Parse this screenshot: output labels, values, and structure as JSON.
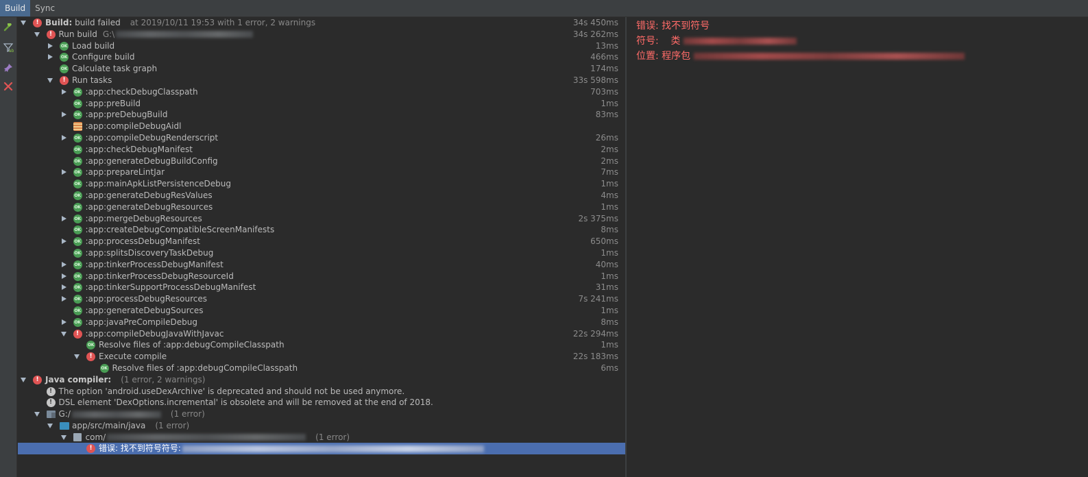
{
  "tabs": [
    "Build",
    "Sync"
  ],
  "toolbar": {
    "icons": [
      "hammer-icon",
      "filter-icon",
      "pin-icon",
      "close-icon"
    ]
  },
  "tree": {
    "rows": [
      {
        "indent": 0,
        "arrow": "exp",
        "icon": "err",
        "bold": "Build:",
        "text": " build failed",
        "dim": "at 2019/10/11 19:53   with 1 error, 2 warnings",
        "time": "34s 450ms"
      },
      {
        "indent": 1,
        "arrow": "exp",
        "icon": "err",
        "text": "Run build",
        "dim": "G:\\",
        "blur": 200,
        "time": "34s 262ms"
      },
      {
        "indent": 2,
        "arrow": "col",
        "icon": "ok",
        "text": "Load build",
        "time": "13ms"
      },
      {
        "indent": 2,
        "arrow": "col",
        "icon": "ok",
        "text": "Configure build",
        "time": "466ms"
      },
      {
        "indent": 2,
        "arrow": "",
        "icon": "ok",
        "text": "Calculate task graph",
        "time": "174ms"
      },
      {
        "indent": 2,
        "arrow": "exp",
        "icon": "err",
        "text": "Run tasks",
        "time": "33s 598ms"
      },
      {
        "indent": 3,
        "arrow": "col",
        "icon": "ok",
        "text": ":app:checkDebugClasspath",
        "time": "703ms"
      },
      {
        "indent": 3,
        "arrow": "",
        "icon": "ok",
        "text": ":app:preBuild",
        "time": "1ms"
      },
      {
        "indent": 3,
        "arrow": "col",
        "icon": "ok",
        "text": ":app:preDebugBuild",
        "time": "83ms"
      },
      {
        "indent": 3,
        "arrow": "",
        "icon": "aidl",
        "text": ":app:compileDebugAidl",
        "time": ""
      },
      {
        "indent": 3,
        "arrow": "col",
        "icon": "ok",
        "text": ":app:compileDebugRenderscript",
        "time": "26ms"
      },
      {
        "indent": 3,
        "arrow": "",
        "icon": "ok",
        "text": ":app:checkDebugManifest",
        "time": "2ms"
      },
      {
        "indent": 3,
        "arrow": "",
        "icon": "ok",
        "text": ":app:generateDebugBuildConfig",
        "time": "2ms"
      },
      {
        "indent": 3,
        "arrow": "col",
        "icon": "ok",
        "text": ":app:prepareLintJar",
        "time": "7ms"
      },
      {
        "indent": 3,
        "arrow": "",
        "icon": "ok",
        "text": ":app:mainApkListPersistenceDebug",
        "time": "1ms"
      },
      {
        "indent": 3,
        "arrow": "",
        "icon": "ok",
        "text": ":app:generateDebugResValues",
        "time": "4ms"
      },
      {
        "indent": 3,
        "arrow": "",
        "icon": "ok",
        "text": ":app:generateDebugResources",
        "time": "1ms"
      },
      {
        "indent": 3,
        "arrow": "col",
        "icon": "ok",
        "text": ":app:mergeDebugResources",
        "time": "2s 375ms"
      },
      {
        "indent": 3,
        "arrow": "",
        "icon": "ok",
        "text": ":app:createDebugCompatibleScreenManifests",
        "time": "8ms"
      },
      {
        "indent": 3,
        "arrow": "col",
        "icon": "ok",
        "text": ":app:processDebugManifest",
        "time": "650ms"
      },
      {
        "indent": 3,
        "arrow": "",
        "icon": "ok",
        "text": ":app:splitsDiscoveryTaskDebug",
        "time": "1ms"
      },
      {
        "indent": 3,
        "arrow": "col",
        "icon": "ok",
        "text": ":app:tinkerProcessDebugManifest",
        "time": "40ms"
      },
      {
        "indent": 3,
        "arrow": "col",
        "icon": "ok",
        "text": ":app:tinkerProcessDebugResourceId",
        "time": "1ms"
      },
      {
        "indent": 3,
        "arrow": "col",
        "icon": "ok",
        "text": ":app:tinkerSupportProcessDebugManifest",
        "time": "31ms"
      },
      {
        "indent": 3,
        "arrow": "col",
        "icon": "ok",
        "text": ":app:processDebugResources",
        "time": "7s 241ms"
      },
      {
        "indent": 3,
        "arrow": "",
        "icon": "ok",
        "text": ":app:generateDebugSources",
        "time": "1ms"
      },
      {
        "indent": 3,
        "arrow": "col",
        "icon": "ok",
        "text": ":app:javaPreCompileDebug",
        "time": "8ms"
      },
      {
        "indent": 3,
        "arrow": "exp",
        "icon": "err",
        "text": ":app:compileDebugJavaWithJavac",
        "time": "22s 294ms"
      },
      {
        "indent": 4,
        "arrow": "",
        "icon": "ok",
        "text": "Resolve files of :app:debugCompileClasspath",
        "time": "1ms"
      },
      {
        "indent": 4,
        "arrow": "exp",
        "icon": "err",
        "text": "Execute compile",
        "time": "22s 183ms"
      },
      {
        "indent": 5,
        "arrow": "",
        "icon": "ok",
        "text": "Resolve files of :app:debugCompileClasspath",
        "time": "6ms"
      },
      {
        "indent": 0,
        "arrow": "exp",
        "icon": "err",
        "bold": "Java compiler:",
        "text": "",
        "dim": "(1 error, 2 warnings)",
        "time": ""
      },
      {
        "indent": 1,
        "arrow": "",
        "icon": "warn",
        "text": "The option 'android.useDexArchive' is deprecated and should not be used anymore.",
        "time": ""
      },
      {
        "indent": 1,
        "arrow": "",
        "icon": "warn",
        "text": "DSL element 'DexOptions.incremental' is obsolete and will be removed at the end of 2018.",
        "time": ""
      },
      {
        "indent": 1,
        "arrow": "exp",
        "icon": "folder",
        "text": "G:/",
        "blur": 130,
        "dim": "(1 error)",
        "time": ""
      },
      {
        "indent": 2,
        "arrow": "exp",
        "icon": "jfolder",
        "text": "app/src/main/java",
        "dim": "(1 error)",
        "time": ""
      },
      {
        "indent": 3,
        "arrow": "exp",
        "icon": "pkg",
        "text": "com/",
        "blur": 290,
        "dim": "(1 error)",
        "time": ""
      },
      {
        "indent": 4,
        "arrow": "",
        "icon": "err",
        "text": "错误: 找不到符号符号:",
        "blur": 440,
        "selected": true,
        "time": ""
      }
    ]
  },
  "console": {
    "lines": [
      {
        "text": "错误: 找不到符号",
        "blur": 0
      },
      {
        "text": "符号:    类 ",
        "blur": 165
      },
      {
        "text": "位置: 程序包 ",
        "blur": 395
      }
    ]
  }
}
